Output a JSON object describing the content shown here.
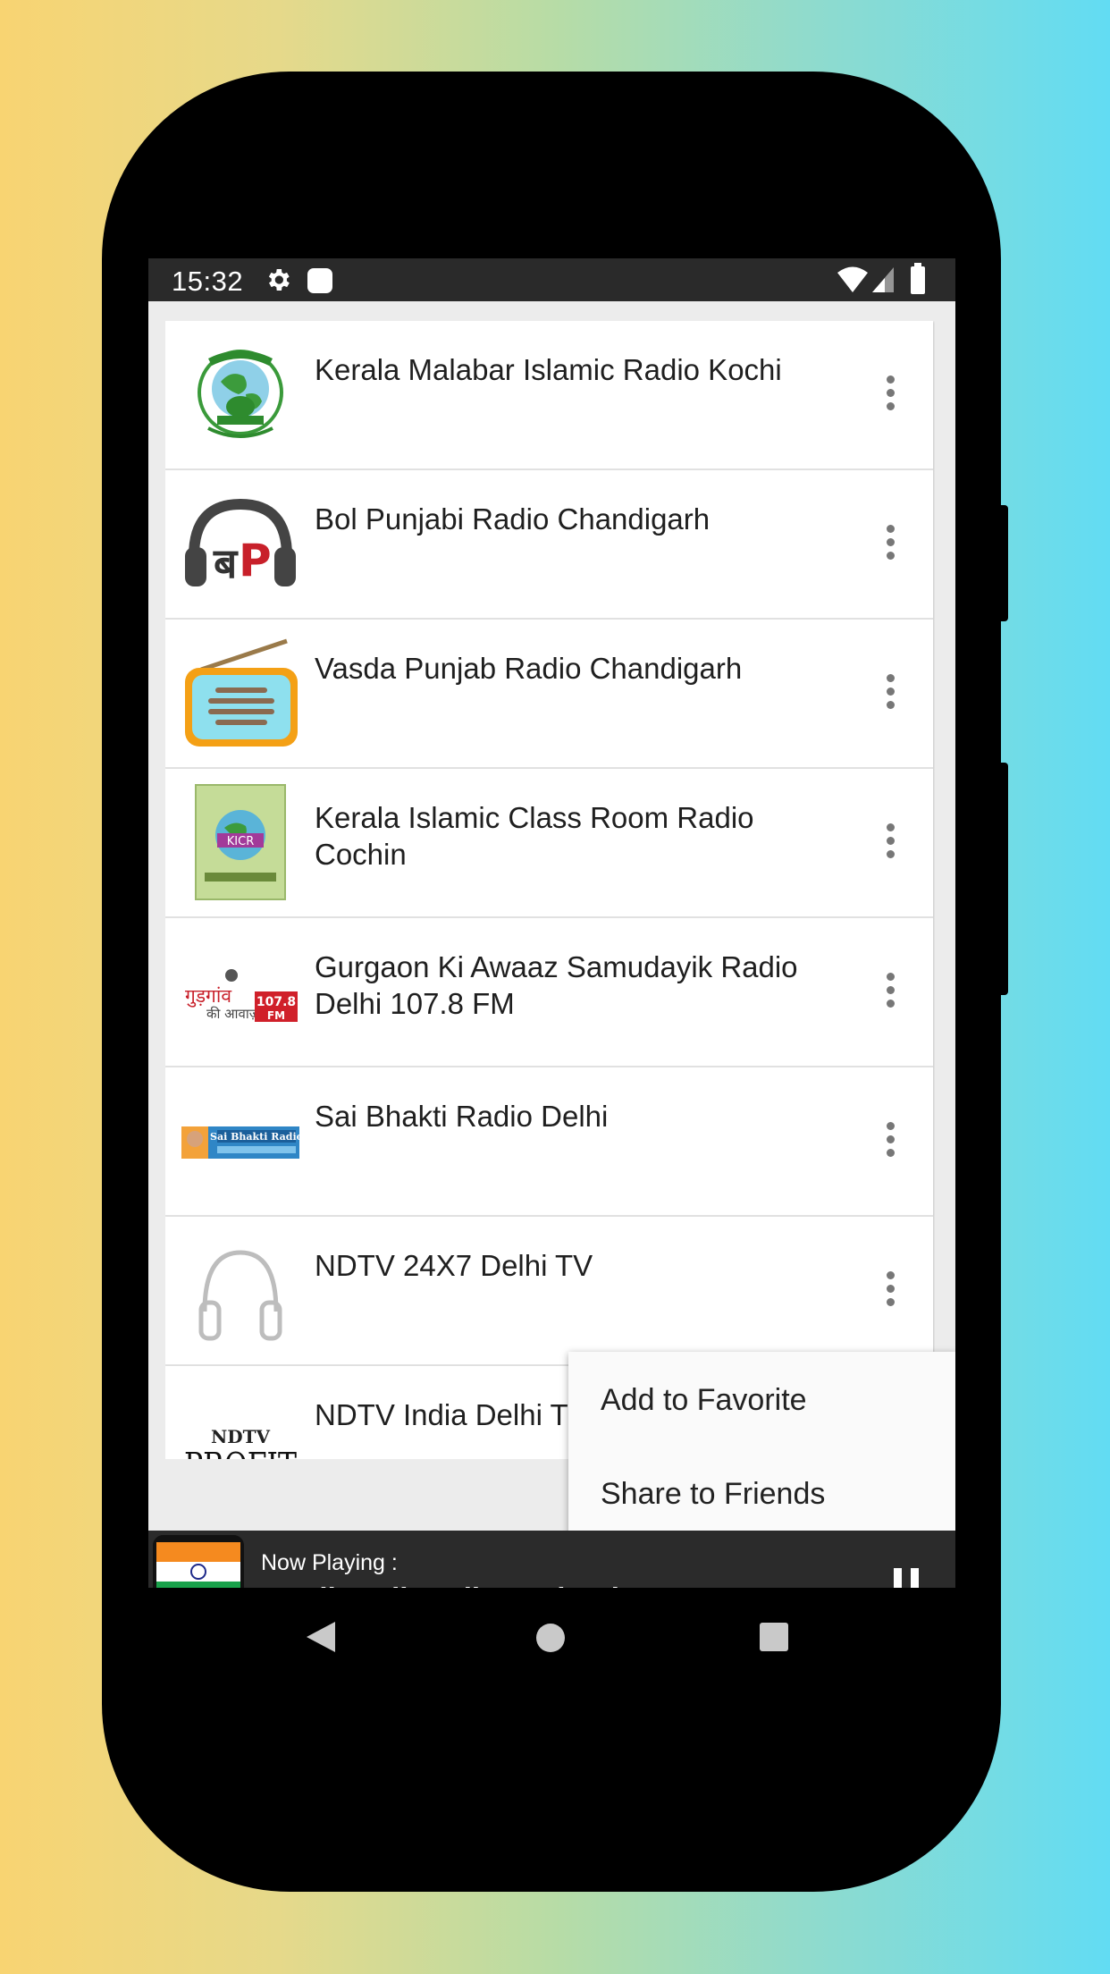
{
  "status_bar": {
    "time": "15:32",
    "icons": [
      "gear-icon",
      "notification-square-icon",
      "wifi-icon",
      "signal-icon",
      "battery-icon"
    ]
  },
  "stations": [
    {
      "name": "Kerala Malabar Islamic Radio Kochi",
      "logo": "globe-mosque-logo"
    },
    {
      "name": "Bol Punjabi Radio Chandigarh",
      "logo": "headphones-bp-logo"
    },
    {
      "name": "Vasda Punjab Radio Chandigarh",
      "logo": "retro-radio-logo"
    },
    {
      "name": "Kerala Islamic Class Room Radio Cochin",
      "logo": "kicr-logo"
    },
    {
      "name": "Gurgaon Ki Awaaz Samudayik Radio Delhi 107.8 FM",
      "logo": "gurgaon-ki-awaaz-logo"
    },
    {
      "name": "Sai Bhakti Radio Delhi",
      "logo": "sai-bhakti-logo"
    },
    {
      "name": "NDTV 24X7 Delhi TV",
      "logo": "headphones-placeholder-logo"
    },
    {
      "name": "NDTV India Delhi TV",
      "logo": "ndtv-profit-logo"
    }
  ],
  "logo_texts": {
    "ndtv_top": "NDTV",
    "ndtv_bottom": "PROFIT",
    "gurgaon_hindi": "गुड़गांव",
    "gurgaon_sub": "की आवाज़",
    "gurgaon_freq": "107.8",
    "gurgaon_fm": "FM",
    "sai_bhakti": "Sai Bhakti Radio",
    "bp_letters": "बP"
  },
  "context_menu": {
    "items": [
      "Add to Favorite",
      "Share to Friends"
    ]
  },
  "player": {
    "label": "Now Playing :",
    "title": "TamilKuyil Radio Madurai"
  },
  "colors": {
    "status_bar": "#2a2a2a",
    "player_bar": "#2b2b2b",
    "list_background": "#ececec",
    "more_icon": "#777777",
    "gradient_left": "#f8d472",
    "gradient_right": "#62dcf3"
  }
}
